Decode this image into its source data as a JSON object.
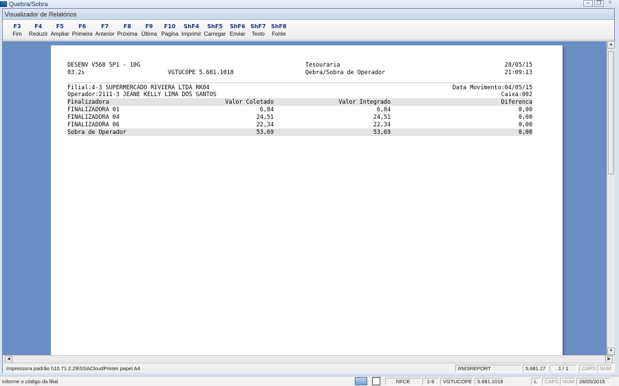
{
  "os_window": {
    "title": "Quebra/Sobra"
  },
  "app_window": {
    "title": "Visualizador de Relatórios"
  },
  "toolbar": [
    {
      "key": "F3",
      "label": "Fim"
    },
    {
      "key": "F4",
      "label": "Reduzir"
    },
    {
      "key": "F5",
      "label": "Ampliar"
    },
    {
      "key": "F6",
      "label": "Primeira"
    },
    {
      "key": "F7",
      "label": "Anterior"
    },
    {
      "key": "F8",
      "label": "Próxima"
    },
    {
      "key": "F9",
      "label": "Última"
    },
    {
      "key": "F10",
      "label": "Página"
    },
    {
      "key": "ShF4",
      "label": "Imprimir"
    },
    {
      "key": "ShF5",
      "label": "Carregar"
    },
    {
      "key": "ShF6",
      "label": "Enviar"
    },
    {
      "key": "ShF7",
      "label": "Texto"
    },
    {
      "key": "ShF8",
      "label": "Fonte"
    }
  ],
  "report": {
    "header": {
      "system": "DESENV V568 SP1 - 10G",
      "department": "Tesouraria",
      "date": "28/05/15",
      "version": "03.2s",
      "program": "VGTUCOPE 5.681.1018",
      "title": "Qebra/Sobra de Operador",
      "time": "21:09:13"
    },
    "filial": "Filial:4-3 SUPERMERCADO RIVIERA LTDA RK04",
    "data_movimento": "Data Movimento:04/05/15",
    "operador": "Operador:2111-3 JEANE KELLY LIMA DOS SANTOS",
    "caixa": "Caixa:002",
    "columns": [
      "Finalizadora",
      "Valor Coletado",
      "Valor Integrado",
      "Diferenca"
    ],
    "rows": [
      [
        "FINALIZADORA 01",
        "6,84",
        "6,84",
        "0,00"
      ],
      [
        "FINALIZADORA 04",
        "24,51",
        "24,51",
        "0,00"
      ],
      [
        "FINALIZADORA 06",
        "22,34",
        "22,34",
        "0,00"
      ]
    ],
    "total": [
      "Sobra de Operador",
      "53,69",
      "53,69",
      "0,00"
    ]
  },
  "app_status": {
    "printer": "Impressora padrão \\\\10.71.2.29\\SSACloudPrinter papel A4",
    "report_name": "RMSREPORT",
    "version": "5.681.17",
    "page": "1 / 1",
    "caps": "CAPS",
    "num": "NUM"
  },
  "system_status": {
    "hint": "Informe o código da filial",
    "mode": "NFCE",
    "range": "1-9",
    "program": "VGTUCOPE",
    "version": "5.681.1018",
    "l": "L",
    "caps": "CAPS",
    "num": "NUM",
    "date": "28/05/2015"
  }
}
